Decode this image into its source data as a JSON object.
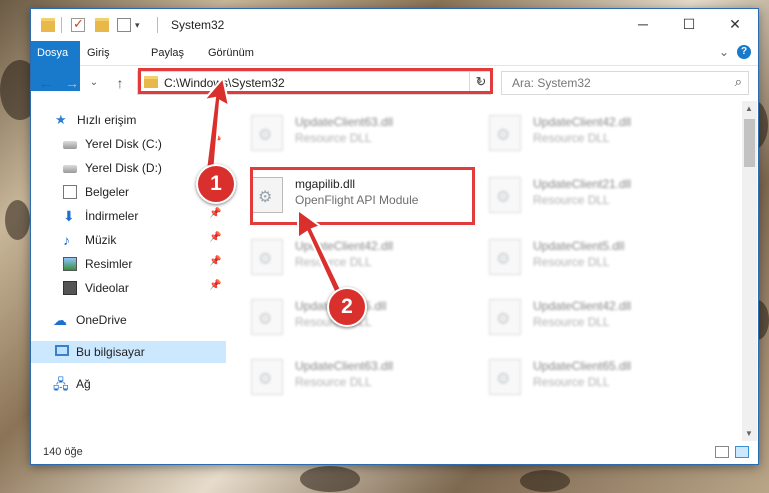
{
  "window": {
    "title": "System32",
    "controls": {
      "minimize": "─",
      "maximize": "☐",
      "close": "✕"
    }
  },
  "ribbon": {
    "tabs": [
      "Dosya",
      "Giriş",
      "Paylaş",
      "Görünüm"
    ],
    "expand": "⌄",
    "help": "?"
  },
  "nav": {
    "back": "←",
    "forward": "→",
    "recent": "⌄",
    "up": "↑",
    "address": "C:\\Windows\\System32",
    "address_dropdown": "⌄",
    "refresh": "↻",
    "search_placeholder": "Ara: System32",
    "search_icon": "⌕"
  },
  "sidebar": {
    "items": [
      {
        "label": "Hızlı erişim",
        "icon": "star-icon"
      },
      {
        "label": "Yerel Disk (C:)",
        "icon": "drive-icon"
      },
      {
        "label": "Yerel Disk (D:)",
        "icon": "drive-icon"
      },
      {
        "label": "Belgeler",
        "icon": "documents-icon"
      },
      {
        "label": "İndirmeler",
        "icon": "downloads-icon"
      },
      {
        "label": "Müzik",
        "icon": "music-icon"
      },
      {
        "label": "Resimler",
        "icon": "pictures-icon"
      },
      {
        "label": "Videolar",
        "icon": "videos-icon"
      },
      {
        "label": "OneDrive",
        "icon": "onedrive-icon"
      },
      {
        "label": "Bu bilgisayar",
        "icon": "this-pc-icon"
      },
      {
        "label": "Ağ",
        "icon": "network-icon"
      }
    ]
  },
  "files": [
    {
      "name": "UpdateClient63.dll",
      "desc": "Resource DLL"
    },
    {
      "name": "UpdateClient42.dll",
      "desc": "Resource DLL"
    },
    {
      "name": "mgapilib.dll",
      "desc": "OpenFlight API Module"
    },
    {
      "name": "UpdateClient21.dll",
      "desc": "Resource DLL"
    },
    {
      "name": "UpdateClient42.dll",
      "desc": "Resource DLL"
    },
    {
      "name": "UpdateClient5.dll",
      "desc": "Resource DLL"
    },
    {
      "name": "UpdateClient5.dll",
      "desc": "Resource DLL"
    },
    {
      "name": "UpdateClient42.dll",
      "desc": "Resource DLL"
    },
    {
      "name": "UpdateClient63.dll",
      "desc": "Resource DLL"
    },
    {
      "name": "UpdateClient65.dll",
      "desc": "Resource DLL"
    }
  ],
  "status": {
    "count": "140 öğe"
  },
  "callouts": {
    "one": "1",
    "two": "2"
  },
  "colors": {
    "accent": "#1979ca",
    "highlight": "#e23b3b",
    "selected": "#cce8ff"
  }
}
